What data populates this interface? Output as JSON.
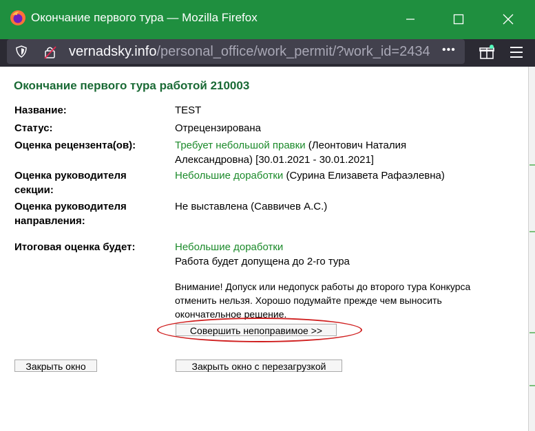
{
  "window": {
    "title": "Окончание первого тура — Mozilla Firefox",
    "url_host": "vernadsky.info",
    "url_path": "/personal_office/work_permit/?work_id=2434",
    "menu_dots": "•••",
    "colors": {
      "titlebar": "#1f8f3f",
      "toolbar": "#2b2a33",
      "heading": "#1a6a35",
      "green_text": "#1b8a2a",
      "highlight": "#d02020"
    }
  },
  "page": {
    "heading": "Окончание первого тура работой 210003",
    "rows": [
      {
        "label": "Название:",
        "value": "TEST"
      },
      {
        "label": "Статус:",
        "value": "Отрецензирована"
      },
      {
        "label": "Оценка рецензента(ов):",
        "value_green": "Требует небольшой правки",
        "value_rest": " (Леонтович Наталия Александровна) [30.01.2021 - 30.01.2021]"
      },
      {
        "label": "Оценка руководителя секции:",
        "value_green": "Небольшие доработки",
        "value_rest": " (Сурина Елизавета Рафаэлевна)"
      },
      {
        "label": "Оценка руководителя направления:",
        "value": "Не выставлена (Саввичев А.С.)"
      }
    ],
    "final": {
      "label": "Итоговая оценка будет:",
      "value_green": "Небольшие доработки",
      "value_line2": "Работа будет допущена до 2-го тура"
    },
    "warning": "Внимание! Допуск или недопуск работы до второго тура Конкурса отменить нельзя. Хорошо подумайте прежде чем выносить окончательное решение.",
    "commit_button": "Совершить непоправимое >>",
    "close_button": "Закрыть окно",
    "close_reload_button": "Закрыть окно с перезагрузкой"
  }
}
